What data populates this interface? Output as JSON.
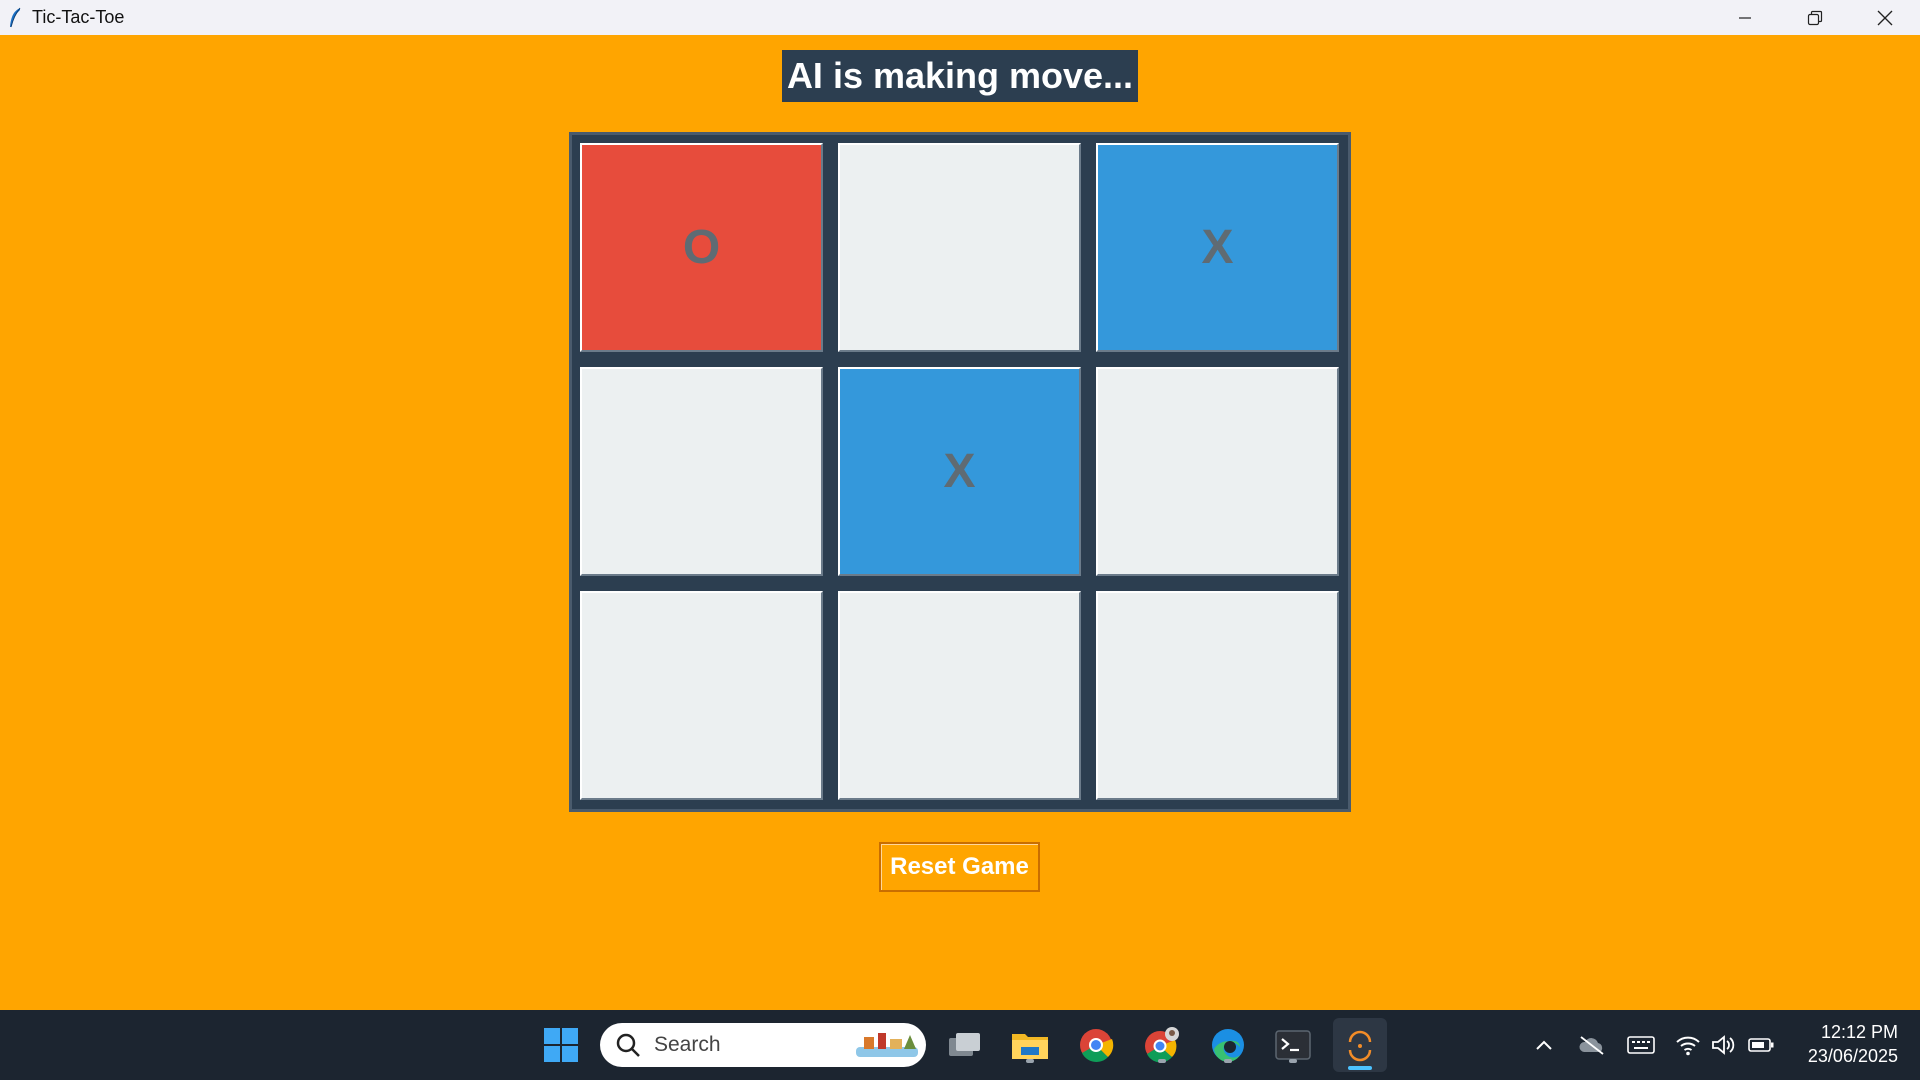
{
  "window": {
    "title": "Tic-Tac-Toe"
  },
  "status": {
    "text": "AI is making move..."
  },
  "board": {
    "cells": [
      {
        "mark": "O",
        "state": "o"
      },
      {
        "mark": "",
        "state": "empty"
      },
      {
        "mark": "X",
        "state": "x"
      },
      {
        "mark": "",
        "state": "empty"
      },
      {
        "mark": "X",
        "state": "x"
      },
      {
        "mark": "",
        "state": "empty"
      },
      {
        "mark": "",
        "state": "empty"
      },
      {
        "mark": "",
        "state": "empty"
      },
      {
        "mark": "",
        "state": "empty"
      }
    ]
  },
  "controls": {
    "reset_label": "Reset Game"
  },
  "taskbar": {
    "search_placeholder": "Search",
    "time": "12:12 PM",
    "date": "23/06/2025"
  },
  "colors": {
    "background": "#ffa500",
    "board": "#2c3e50",
    "o_cell": "#e74c3c",
    "x_cell": "#3498db",
    "empty_cell": "#ecf0f1"
  }
}
